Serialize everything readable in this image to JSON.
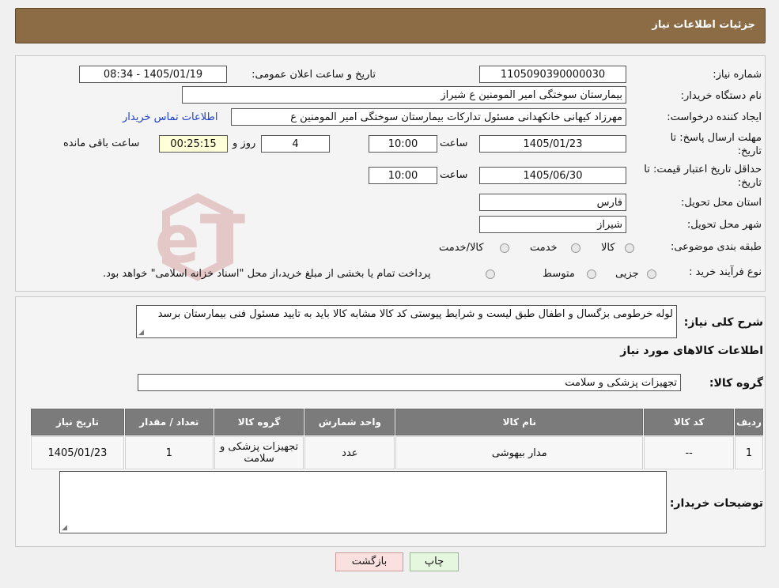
{
  "header": {
    "title": "جزئیات اطلاعات نیاز"
  },
  "form": {
    "need_number_label": "شماره نیاز:",
    "need_number": "1105090390000030",
    "announce_label": "تاریخ و ساعت اعلان عمومی:",
    "announce_value": "1405/01/19 - 08:34",
    "buyer_label": "نام دستگاه خریدار:",
    "buyer_value": "بیمارستان سوختگی امیر المومنین  ع  شیراز",
    "creator_label": "ایجاد کننده درخواست:",
    "creator_value": "مهرزاد کیهانی خانکهدانی مسئول تدارکات بیمارستان سوختگی امیر المومنین  ع",
    "contact_link": "اطلاعات تماس خریدار",
    "deadline_label_1": "مهلت ارسال پاسخ: تا",
    "deadline_label_2": "تاریخ:",
    "deadline_date": "1405/01/23",
    "time_label": "ساعت",
    "deadline_time": "10:00",
    "days_value": "4",
    "days_label": "روز و",
    "remaining_time": "00:25:15",
    "remaining_label": "ساعت باقی مانده",
    "validity_label_1": "حداقل تاریخ اعتبار قیمت: تا",
    "validity_label_2": "تاریخ:",
    "validity_date": "1405/06/30",
    "validity_time": "10:00",
    "province_label": "استان محل تحویل:",
    "province_value": "فارس",
    "city_label": "شهر محل تحویل:",
    "city_value": "شیراز",
    "category_label": "طبقه بندی موضوعی:",
    "category_options": [
      "کالا",
      "خدمت",
      "کالا/خدمت"
    ],
    "process_label": "نوع فرآیند خرید :",
    "process_options": [
      "جزیی",
      "متوسط"
    ],
    "process_note": "پرداخت تمام یا بخشی از مبلغ خرید،از محل \"اسناد خزانه اسلامی\" خواهد بود."
  },
  "description": {
    "label": "شرح کلی نیاز:",
    "text": "لوله خرطومی بزگسال و اطفال طبق لیست و شرایط پیوستی کد کالا مشابه کالا باید به تایید مسئول فنی بیمارستان برسد"
  },
  "goods": {
    "section_title": "اطلاعات کالاهای مورد نیاز",
    "group_label": "گروه کالا:",
    "group_value": "تجهیزات پزشکی و سلامت",
    "columns": [
      "ردیف",
      "کد کالا",
      "نام کالا",
      "واحد شمارش",
      "گروه کالا",
      "تعداد / مقدار",
      "تاریخ نیاز"
    ],
    "rows": [
      [
        "1",
        "--",
        "مدار بیهوشی",
        "عدد",
        "تجهیزات پزشکی و سلامت",
        "1",
        "1405/01/23"
      ]
    ]
  },
  "buyer_notes": {
    "label": "توضیحات خریدار:"
  },
  "buttons": {
    "print": "چاپ",
    "back": "بازگشت"
  },
  "watermark": {
    "text": "AriaTender.neT"
  },
  "colors": {
    "header_bg": "#8b6c44",
    "link": "#1a3fd1",
    "table_header": "#7b7b7b",
    "yellow_field": "#ffffd8"
  }
}
